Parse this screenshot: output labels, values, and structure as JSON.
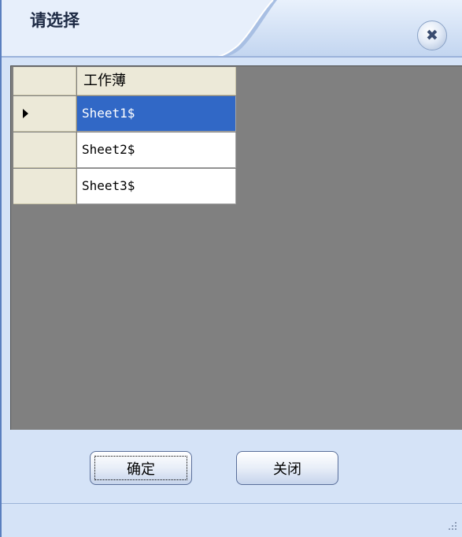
{
  "window": {
    "title": "请选择"
  },
  "grid": {
    "column_header": "工作薄",
    "rows": [
      {
        "value": "Sheet1$",
        "selected": true
      },
      {
        "value": "Sheet2$",
        "selected": false
      },
      {
        "value": "Sheet3$",
        "selected": false
      }
    ]
  },
  "buttons": {
    "ok_label": "确定",
    "close_label": "关闭"
  },
  "icons": {
    "close": "close-icon",
    "row_pointer": "row-pointer-icon",
    "resize_grip": "resize-grip-icon"
  },
  "colors": {
    "selection": "#3168c6",
    "grid_background": "#808080",
    "window_background": "#d5e3f7"
  }
}
